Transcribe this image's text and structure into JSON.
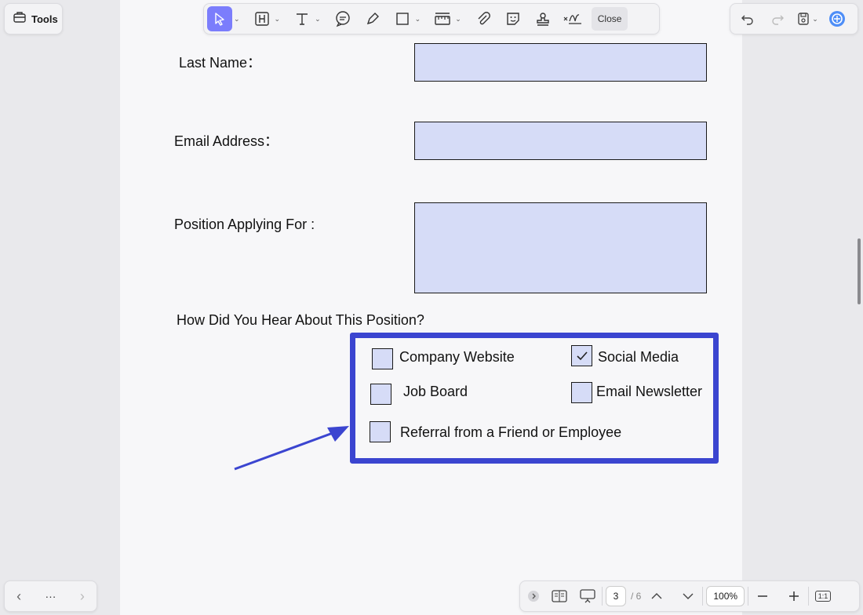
{
  "toolbar": {
    "tools_label": "Tools",
    "close_label": "Close",
    "accent": "#7b7dfc"
  },
  "form": {
    "last_name_label": "Last Name：",
    "email_label": "Email Address：",
    "position_label": "Position Applying For :",
    "hear_question": "How Did You Hear About This Position?",
    "options": {
      "company_website": "Company Website",
      "social_media": "Social Media",
      "job_board": "Job Board",
      "email_newsletter": "Email Newsletter",
      "referral": "Referral from a Friend or Employee"
    },
    "checked": {
      "company_website": false,
      "social_media": true,
      "job_board": false,
      "email_newsletter": false,
      "referral": false
    },
    "field_color": "#d6dcf7",
    "highlight_color": "#3b45d0"
  },
  "nav": {
    "more": "···"
  },
  "footer": {
    "current_page": "3",
    "total_pages": "/ 6",
    "zoom": "100%",
    "fit_label": "1:1"
  }
}
